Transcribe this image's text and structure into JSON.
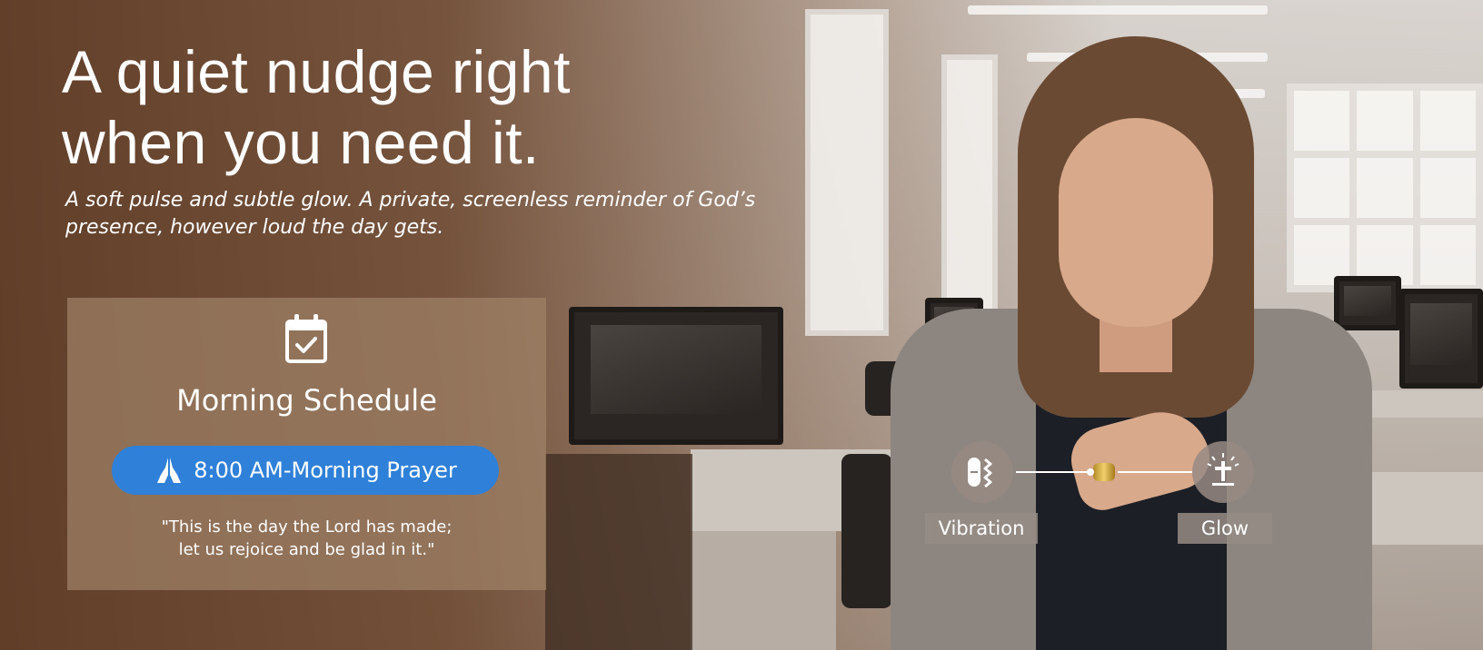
{
  "headline": {
    "line1": "A quiet nudge right",
    "line2": "when you need it."
  },
  "subhead": {
    "line1": "A soft pulse and subtle glow. A private, screenless reminder of God’s",
    "line2": "presence, however loud the day gets."
  },
  "card": {
    "icon": "calendar-check-icon",
    "title": "Morning Schedule",
    "reminder": {
      "icon": "praying-hands-icon",
      "label": "8:00 AM-Morning Prayer"
    },
    "verse": {
      "line1": "\"This is the day the Lord has made;",
      "line2": "let us rejoice and be glad in it.\""
    }
  },
  "features": [
    {
      "icon": "vibration-icon",
      "label": "Vibration"
    },
    {
      "icon": "glow-cross-icon",
      "label": "Glow"
    }
  ],
  "colors": {
    "brand_brown": "#5f3c26",
    "pill_blue": "#2f80d8",
    "text": "#ffffff"
  }
}
